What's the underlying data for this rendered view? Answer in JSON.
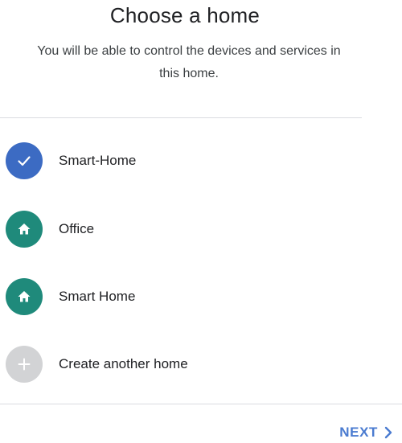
{
  "header": {
    "title": "Choose a home",
    "subtitle": "You will be able to control the devices and services in this home."
  },
  "homes": [
    {
      "label": "Smart-Home",
      "icon": "check-icon",
      "color": "#3c6bc3",
      "selected": true
    },
    {
      "label": "Office",
      "icon": "house-icon",
      "color": "#1f8a7b",
      "selected": false
    },
    {
      "label": "Smart Home",
      "icon": "house-icon",
      "color": "#1f8a7b",
      "selected": false
    }
  ],
  "create_home": {
    "label": "Create another home",
    "icon": "plus-icon",
    "color": "#d2d3d5"
  },
  "footer": {
    "next_label": "NEXT",
    "next_icon": "chevron-right-icon",
    "accent": "#4a7bd0"
  }
}
